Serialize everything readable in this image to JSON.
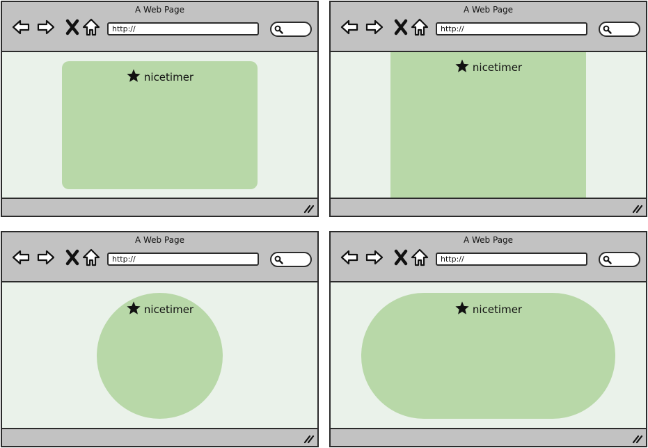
{
  "browser": {
    "window_title": "A Web Page",
    "url_value": "http://",
    "icons": {
      "back": "arrow-left-icon",
      "forward": "arrow-right-icon",
      "stop": "close-icon",
      "home": "home-icon",
      "search": "search-icon",
      "star": "star-icon",
      "resize": "resize-grip-icon"
    }
  },
  "widget": {
    "title": "nicetimer"
  },
  "frames": [
    {
      "widget_shape": "rounded-rectangle"
    },
    {
      "widget_shape": "rectangle"
    },
    {
      "widget_shape": "circle"
    },
    {
      "widget_shape": "pill"
    }
  ],
  "colors": {
    "chrome": "#c2c2c2",
    "page_background": "#eaf2ea",
    "widget_fill": "#b8d8a8",
    "outline": "#2b2b2b"
  }
}
